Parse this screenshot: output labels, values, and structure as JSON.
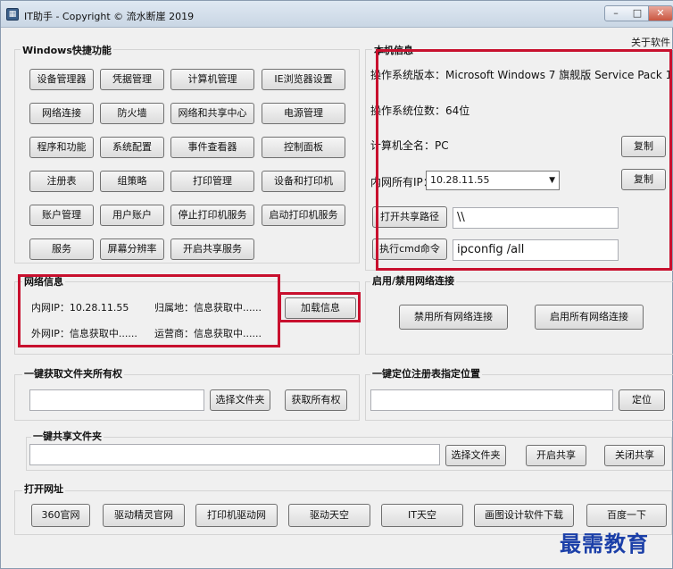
{
  "window": {
    "title": "IT助手 - Copyright © 流水断崖 2019",
    "about": "关于软件"
  },
  "windows_shortcuts": {
    "label": "Windows快捷功能",
    "buttons": [
      "设备管理器",
      "凭据管理",
      "计算机管理",
      "IE浏览器设置",
      "网络连接",
      "防火墙",
      "网络和共享中心",
      "电源管理",
      "程序和功能",
      "系统配置",
      "事件查看器",
      "控制面板",
      "注册表",
      "组策略",
      "打印管理",
      "设备和打印机",
      "账户管理",
      "用户账户",
      "停止打印机服务",
      "启动打印机服务",
      "服务",
      "屏幕分辨率",
      "开启共享服务"
    ]
  },
  "local_info": {
    "label": "本机信息",
    "os_version": "操作系统版本：Microsoft Windows 7 旗舰版  Service Pack 1",
    "os_bits": "操作系统位数：64位",
    "computer_name": "计算机全名：PC",
    "copy_label": "复制",
    "all_ip_label": "内网所有IP：",
    "all_ip_selected": "10.28.11.55",
    "open_share_label": "打开共享路径",
    "share_path_value": "\\\\",
    "exec_cmd_label": "执行cmd命令",
    "cmd_value": "ipconfig /all"
  },
  "network_info": {
    "label": "网络信息",
    "lan_ip": "内网IP：10.28.11.55",
    "location": "归属地：信息获取中......",
    "wan_ip": "外网IP：信息获取中......",
    "isp": "运营商：信息获取中......",
    "load_button": "加载信息"
  },
  "toggle_network": {
    "label": "启用/禁用网络连接",
    "disable_all": "禁用所有网络连接",
    "enable_all": "启用所有网络连接"
  },
  "folder_owner": {
    "label": "一键获取文件夹所有权",
    "select_folder": "选择文件夹",
    "take_ownership": "获取所有权"
  },
  "registry_locate": {
    "label": "一键定位注册表指定位置",
    "locate": "定位"
  },
  "share_folder": {
    "label": "一键共享文件夹",
    "select_folder": "选择文件夹",
    "start_share": "开启共享",
    "stop_share": "关闭共享"
  },
  "websites": {
    "label": "打开网址",
    "buttons": [
      "360官网",
      "驱动精灵官网",
      "打印机驱动网",
      "驱动天空",
      "IT天空",
      "画图设计软件下载",
      "百度一下"
    ]
  },
  "watermark": "最需教育"
}
